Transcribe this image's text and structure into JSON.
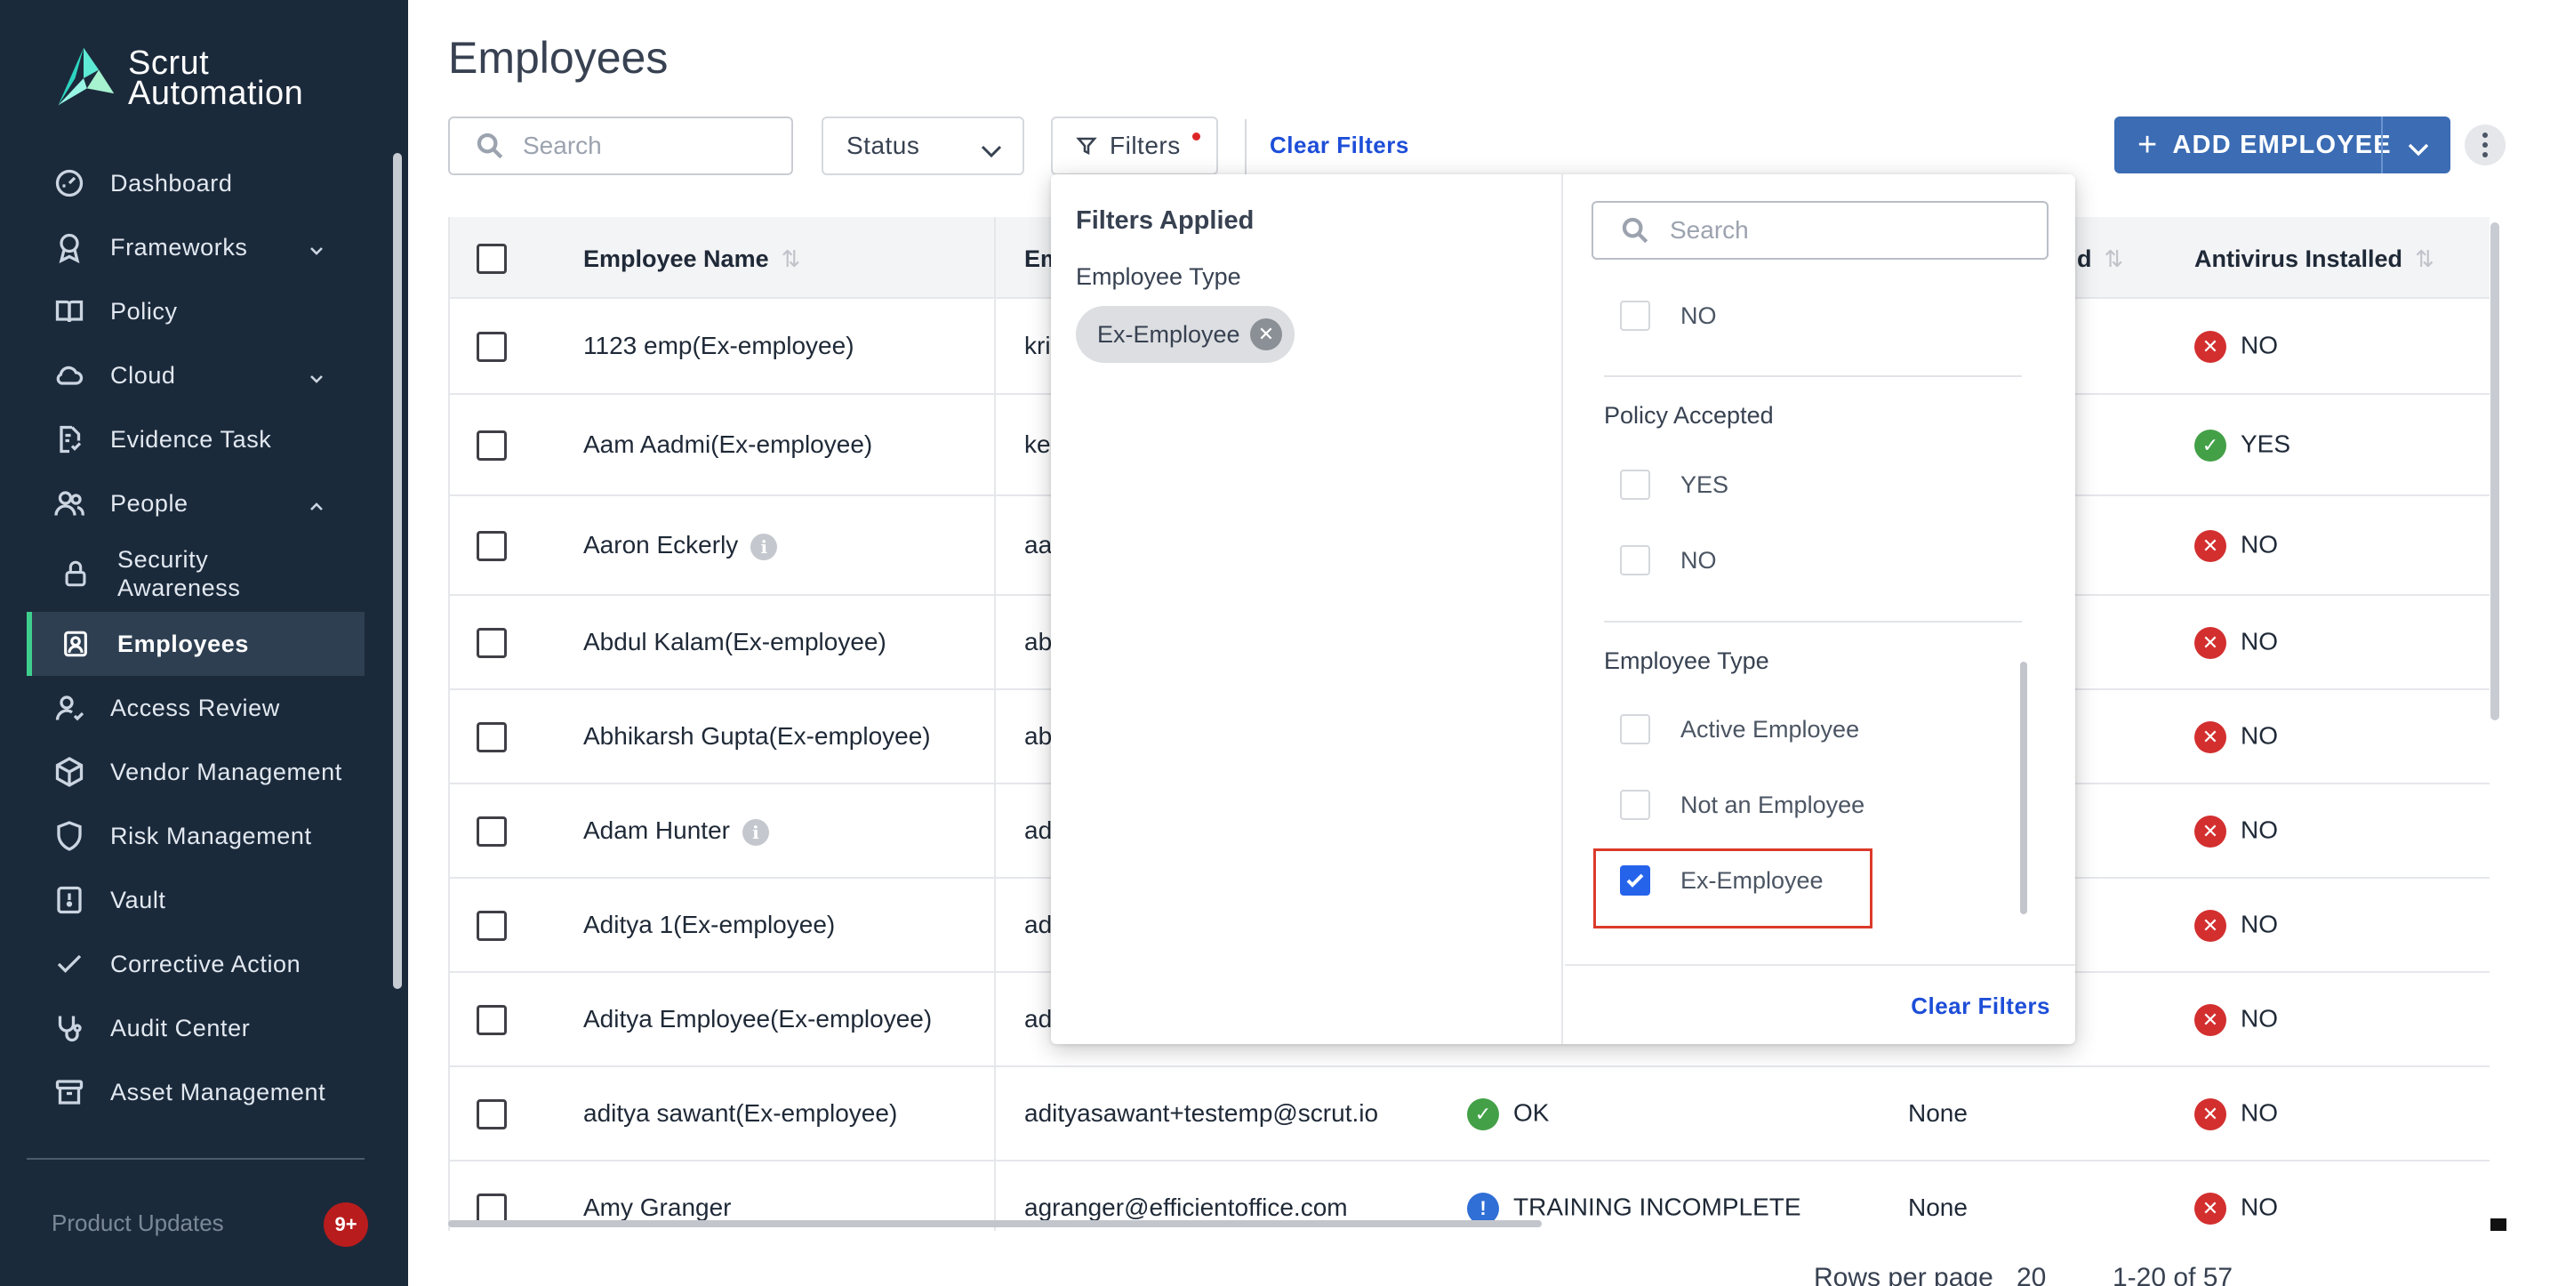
{
  "app": {
    "logo_line1": "Scrut",
    "logo_line2": "Automation"
  },
  "sidebar": {
    "items": [
      {
        "label": "Dashboard",
        "icon": "dashboard-icon"
      },
      {
        "label": "Frameworks",
        "icon": "award-icon",
        "expandable": true
      },
      {
        "label": "Policy",
        "icon": "book-icon"
      },
      {
        "label": "Cloud",
        "icon": "cloud-icon",
        "expandable": true
      },
      {
        "label": "Evidence Task",
        "icon": "document-check-icon"
      },
      {
        "label": "People",
        "icon": "people-icon",
        "expanded": true
      },
      {
        "label": "Security Awareness",
        "icon": "lock-icon",
        "sub": true
      },
      {
        "label": "Employees",
        "icon": "badge-icon",
        "sub": true,
        "active": true
      },
      {
        "label": "Access Review",
        "icon": "user-icon"
      },
      {
        "label": "Vendor Management",
        "icon": "box-icon"
      },
      {
        "label": "Risk Management",
        "icon": "shield-icon"
      },
      {
        "label": "Vault",
        "icon": "vault-icon"
      },
      {
        "label": "Corrective Action",
        "icon": "check-icon"
      },
      {
        "label": "Audit Center",
        "icon": "stethoscope-icon"
      },
      {
        "label": "Asset Management",
        "icon": "archive-icon"
      }
    ],
    "bottom_label": "Product Updates",
    "notification_badge": "9+"
  },
  "page": {
    "title": "Employees"
  },
  "toolbar": {
    "search_placeholder": "Search",
    "status_label": "Status",
    "filters_label": "Filters",
    "clear_filters_label": "Clear Filters",
    "add_employee_label": "ADD EMPLOYEE"
  },
  "table": {
    "columns": {
      "employee_name": "Employee Name",
      "email": "Em",
      "hidden_header": "d",
      "antivirus": "Antivirus Installed"
    },
    "rows": [
      {
        "name": "1123 emp(Ex-employee)",
        "email": "kri",
        "antivirus": "NO",
        "antivirus_ok": false
      },
      {
        "name": "Aam Aadmi(Ex-employee)",
        "email": "ke",
        "antivirus": "YES",
        "antivirus_ok": true
      },
      {
        "name": "Aaron Eckerly",
        "email": "aa",
        "antivirus": "NO",
        "antivirus_ok": false,
        "info": true
      },
      {
        "name": "Abdul Kalam(Ex-employee)",
        "email": "ab",
        "antivirus": "NO",
        "antivirus_ok": false
      },
      {
        "name": "Abhikarsh Gupta(Ex-employee)",
        "email": "ab",
        "antivirus": "NO",
        "antivirus_ok": false
      },
      {
        "name": "Adam Hunter",
        "email": "ad",
        "antivirus": "NO",
        "antivirus_ok": false,
        "info": true
      },
      {
        "name": "Aditya 1(Ex-employee)",
        "email": "ad",
        "antivirus": "NO",
        "antivirus_ok": false
      },
      {
        "name": "Aditya Employee(Ex-employee)",
        "email": "ad",
        "antivirus": "NO",
        "antivirus_ok": false
      },
      {
        "name": "aditya sawant(Ex-employee)",
        "email": "adityasawant+testemp@scrut.io",
        "status": "OK",
        "status_kind": "ok",
        "col4": "None",
        "antivirus": "NO",
        "antivirus_ok": false
      },
      {
        "name": "Amy Granger",
        "email": "agranger@efficientoffice.com",
        "status": "TRAINING INCOMPLETE",
        "status_kind": "warn",
        "col4": "None",
        "antivirus": "NO",
        "antivirus_ok": false
      }
    ]
  },
  "pagination": {
    "rows_per_page_label": "Rows per page",
    "rows_per_page_value": "20",
    "range": "1-20 of 57"
  },
  "filter_panel": {
    "applied_title": "Filters Applied",
    "applied_group": "Employee Type",
    "applied_chip": "Ex-Employee",
    "search_placeholder": "Search",
    "top_option": "NO",
    "policy_section": "Policy Accepted",
    "policy_options": [
      "YES",
      "NO"
    ],
    "type_section": "Employee Type",
    "type_options": [
      {
        "label": "Active Employee",
        "checked": false
      },
      {
        "label": "Not an Employee",
        "checked": false
      },
      {
        "label": "Ex-Employee",
        "checked": true
      }
    ],
    "clear_label": "Clear Filters"
  }
}
